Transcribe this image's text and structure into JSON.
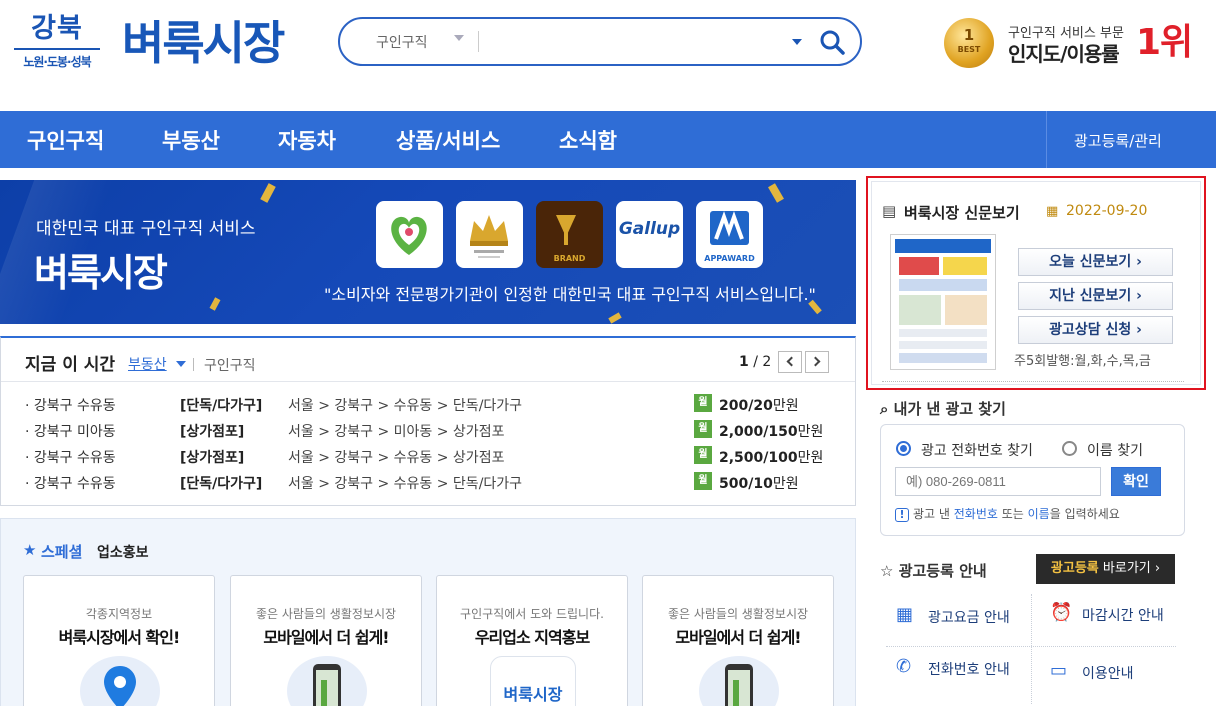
{
  "header": {
    "region_line1": "강북",
    "region_line2": "노원·도봉·성북",
    "site_name": "벼룩시장",
    "search": {
      "category": "구인구직",
      "value": "",
      "placeholder": ""
    },
    "award": {
      "medal_num": "1",
      "medal_text": "BEST",
      "sub": "구인구직 서비스 부문",
      "main": "인지도/이용률",
      "rank": "1위"
    }
  },
  "nav": {
    "items": [
      "구인구직",
      "부동산",
      "자동차",
      "상품/서비스",
      "소식함"
    ],
    "right": "광고등록/관리"
  },
  "banner": {
    "tagline": "대한민국 대표 구인구직 서비스",
    "title": "벼룩시장",
    "badges": [
      "BRAND",
      "Gallup",
      "APPAWARD"
    ],
    "quote": "\"소비자와 전문평가기관이 인정한 대한민국 대표 구인구직 서비스입니다.\""
  },
  "now": {
    "title": "지금 이 시간",
    "active_tab": "부동산",
    "other_tab": "구인구직",
    "page_current": "1",
    "page_total": " / 2",
    "rows": [
      {
        "area": "· 강북구 수유동",
        "type": "[단독/다가구]",
        "loc": "서울 > 강북구 > 수유동 > 단독/다가구",
        "badge": "월",
        "price": "200/20",
        "unit": "만원"
      },
      {
        "area": "· 강북구 미아동",
        "type": "[상가점포]",
        "loc": "서울 > 강북구 > 미아동 > 상가점포",
        "badge": "월",
        "price": "2,000/150",
        "unit": "만원"
      },
      {
        "area": "· 강북구 수유동",
        "type": "[상가점포]",
        "loc": "서울 > 강북구 > 수유동 > 상가점포",
        "badge": "월",
        "price": "2,500/100",
        "unit": "만원"
      },
      {
        "area": "· 강북구 수유동",
        "type": "[단독/다가구]",
        "loc": "서울 > 강북구 > 수유동 > 단독/다가구",
        "badge": "월",
        "price": "500/10",
        "unit": "만원"
      }
    ]
  },
  "special": {
    "title": "스페셜",
    "subtitle": "업소홍보",
    "cards": [
      {
        "sub": "각종지역정보",
        "main": "벼룩시장에서 확인!"
      },
      {
        "sub": "좋은 사람들의 생활정보시장",
        "main": "모바일에서 더 쉽게!"
      },
      {
        "sub": "구인구직에서 도와 드립니다.",
        "main": "우리업소 지역홍보"
      },
      {
        "sub": "좋은 사람들의 생활정보시장",
        "main": "모바일에서 더 쉽게!"
      }
    ],
    "card3_logo": "벼룩시장"
  },
  "paper": {
    "title": "벼룩시장 신문보기",
    "date": "2022-09-20",
    "buttons": [
      "오늘 신문보기 ›",
      "지난 신문보기 ›",
      "광고상담 신청 ›"
    ],
    "frequency": "주5회발행:월,화,수,목,금"
  },
  "find": {
    "title": "내가 낸 광고 찾기",
    "opt1": "광고 전화번호 찾기",
    "opt2": "이름 찾기",
    "placeholder": "예) 080-269-0811",
    "confirm": "확인",
    "hint_pre": "광고 낸 ",
    "hint_phone": "전화번호",
    "hint_mid": " 또는 ",
    "hint_name": "이름",
    "hint_post": "을 입력하세요"
  },
  "guide": {
    "title": "광고등록 안내",
    "reg_btn_y": "광고등록",
    "reg_btn_rest": " 바로가기 ›",
    "items": [
      "광고요금 안내",
      "마감시간 안내",
      "전화번호 안내",
      "이용안내"
    ]
  },
  "colors": {
    "brand": "#2f6dd6",
    "highlight_border": "#e0131f",
    "badge_green": "#5aa840"
  }
}
